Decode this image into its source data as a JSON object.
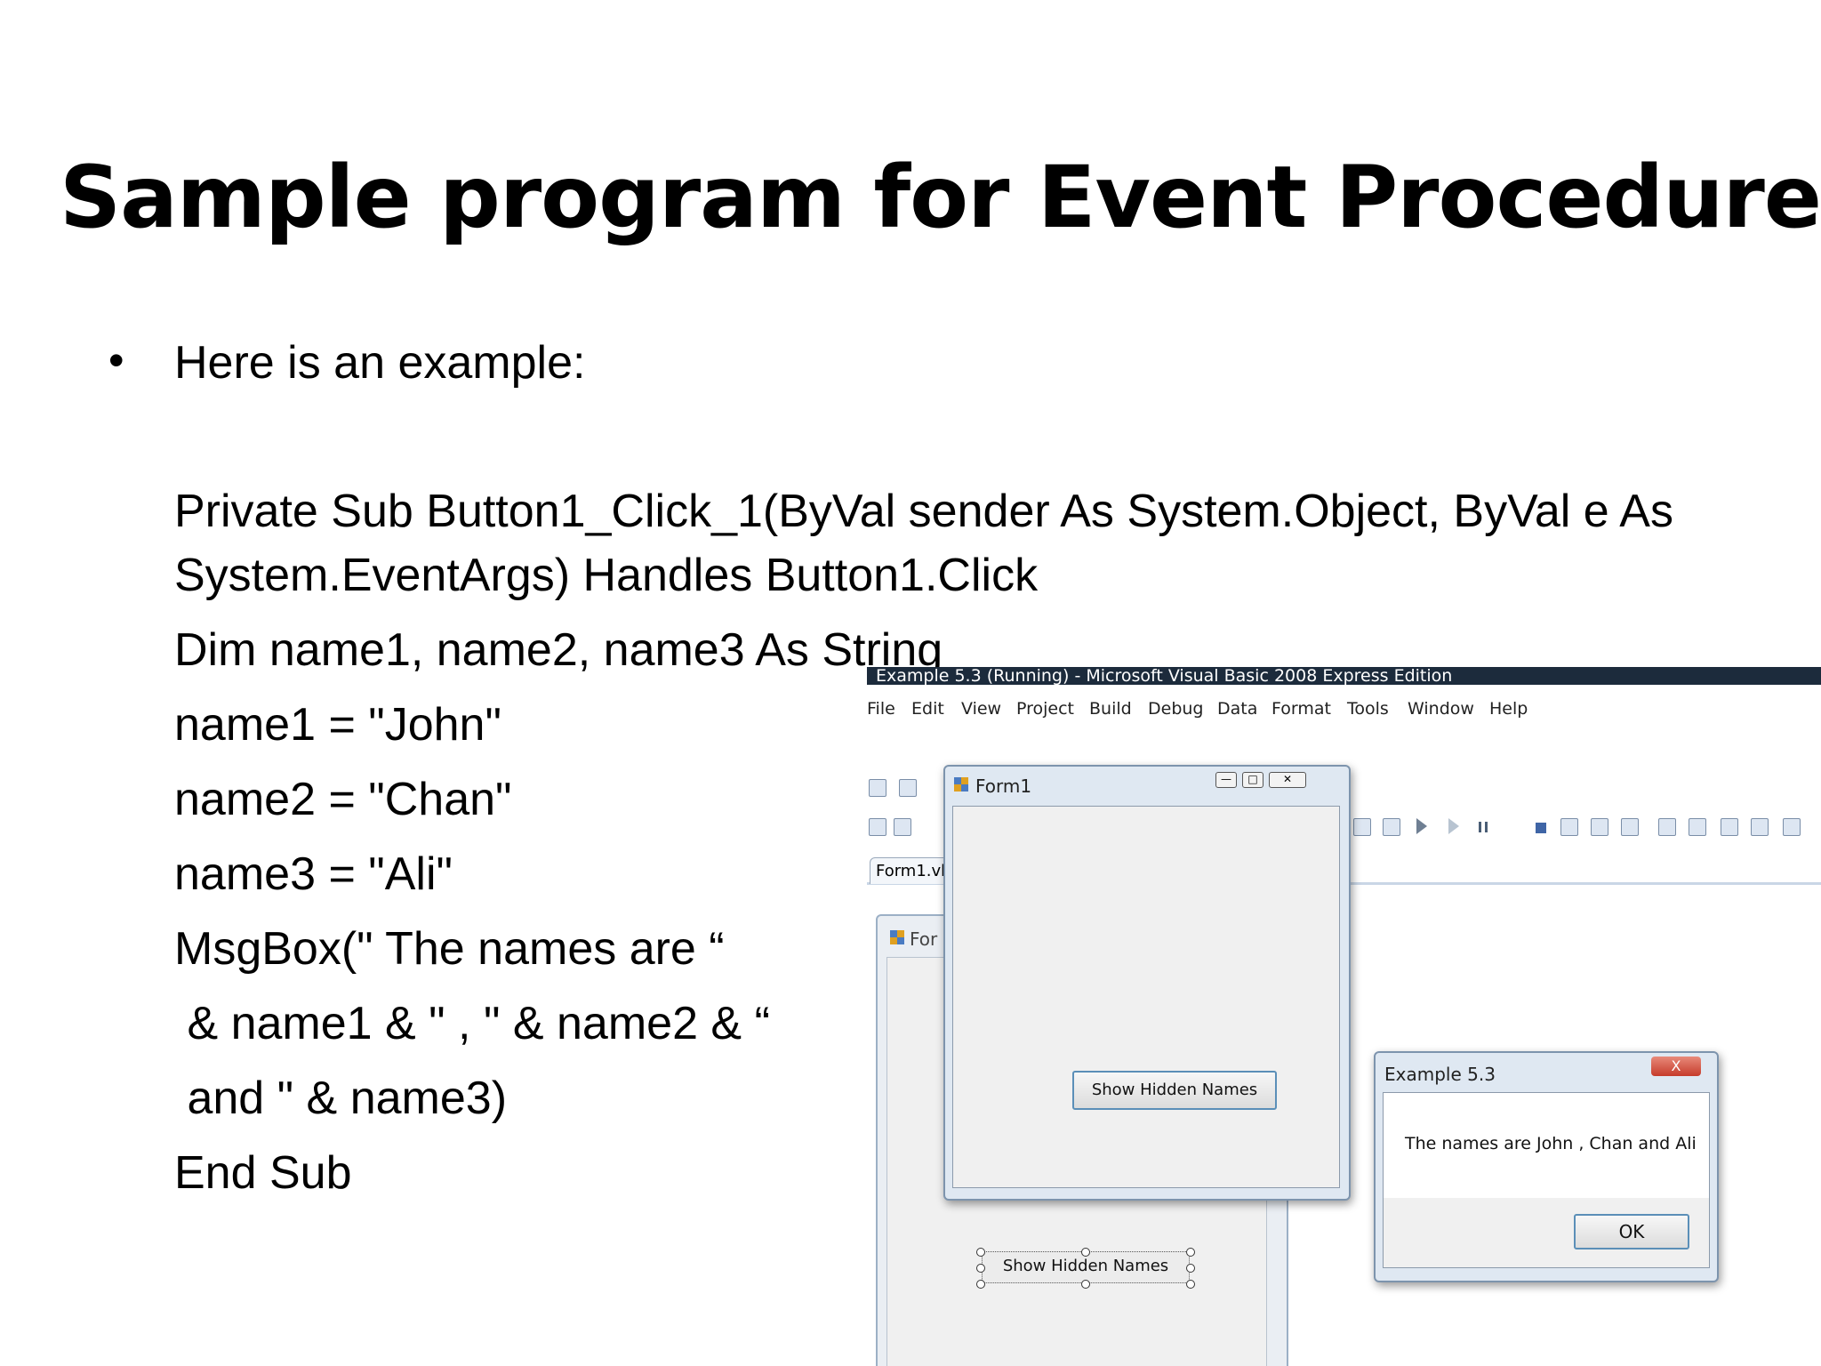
{
  "slide": {
    "title": "Sample program for Event Procedure",
    "bullet_char": "•",
    "bullet_text": "Here is an example:",
    "code_lines": [
      "Private Sub Button1_Click_1(ByVal sender As System.Object, ByVal e As",
      "System.EventArgs) Handles Button1.Click",
      "Dim name1, name2, name3 As String",
      "name1 = \"John\"",
      "name2 = \"Chan\"",
      "name3 = \"Ali\"",
      "MsgBox(\" The names are “",
      " & name1 & \" , \" & name2 & “",
      " and \" & name3)",
      "End Sub"
    ]
  },
  "screenshot": {
    "ide_title": "Example 5.3 (Running) - Microsoft Visual Basic 2008 Express Edition",
    "menu": [
      "File",
      "Edit",
      "View",
      "Project",
      "Build",
      "Debug",
      "Data",
      "Format",
      "Tools",
      "Window",
      "Help"
    ],
    "tab_label": "Form1.vb",
    "bg_form_title": "For",
    "bg_button_label": "Show Hidden Names",
    "form_title": "Form1",
    "form_button_label": "Show Hidden Names",
    "msgbox_title": "Example 5.3",
    "msgbox_close": "X",
    "msgbox_text": "The names are John , Chan and Ali",
    "msgbox_ok": "OK"
  }
}
